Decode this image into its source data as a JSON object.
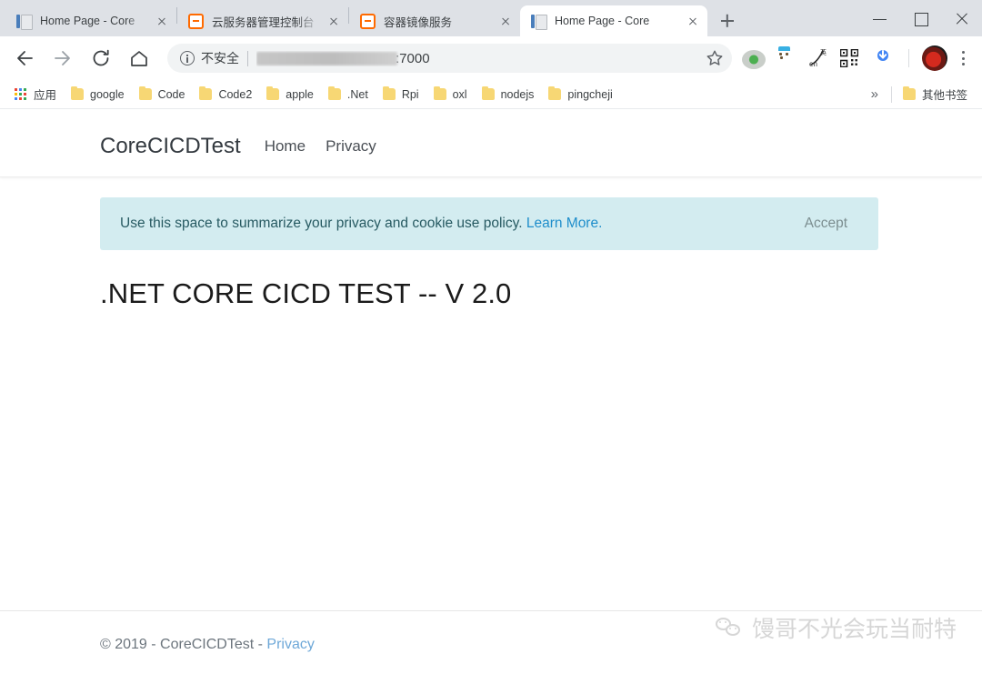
{
  "browser": {
    "tabs": [
      {
        "title": "Home Page - Core",
        "favicon": "document-icon",
        "active": false
      },
      {
        "title": "云服务器管理控制台",
        "favicon": "aliyun-icon",
        "active": false
      },
      {
        "title": "容器镜像服务",
        "favicon": "aliyun-icon",
        "active": false
      },
      {
        "title": "Home Page - Core",
        "favicon": "document-icon",
        "active": true
      }
    ],
    "new_tab_label": "+",
    "window_controls": {
      "minimize": "minimize-icon",
      "maximize": "maximize-icon",
      "close": "close-icon"
    },
    "toolbar": {
      "back": "back-arrow-icon",
      "forward": "forward-arrow-icon",
      "reload": "reload-icon",
      "home": "home-icon",
      "security_label": "不安全",
      "url_visible_suffix": ":7000",
      "url_redacted": true,
      "bookmark_star": "star-icon",
      "extensions": [
        "green-dot-extension-icon",
        "robot-clipboard-extension-icon",
        "translate-extension-icon",
        "qr-code-extension-icon",
        "chrome-download-extension-icon"
      ],
      "avatar": "profile-avatar",
      "menu": "kebab-menu-icon"
    },
    "bookmarks": {
      "apps_label": "应用",
      "items": [
        "google",
        "Code",
        "Code2",
        "apple",
        ".Net",
        "Rpi",
        "oxl",
        "nodejs",
        "pingcheji"
      ],
      "overflow_label": "»",
      "other_label": "其他书签"
    }
  },
  "site": {
    "brand": "CoreCICDTest",
    "nav": [
      {
        "label": "Home"
      },
      {
        "label": "Privacy"
      }
    ],
    "cookie_banner": {
      "text": "Use this space to summarize your privacy and cookie use policy. ",
      "link_label": "Learn More.",
      "accept_label": "Accept",
      "background": "#d3ecf0",
      "link_color": "#1f8ecb"
    },
    "heading": ".NET CORE CICD TEST -- V 2.0",
    "footer": {
      "copyright": "© 2019 - CoreCICDTest - ",
      "privacy_label": "Privacy"
    }
  },
  "watermark": {
    "logo": "wechat-icon",
    "text": "馒哥不光会玩当耐特"
  }
}
